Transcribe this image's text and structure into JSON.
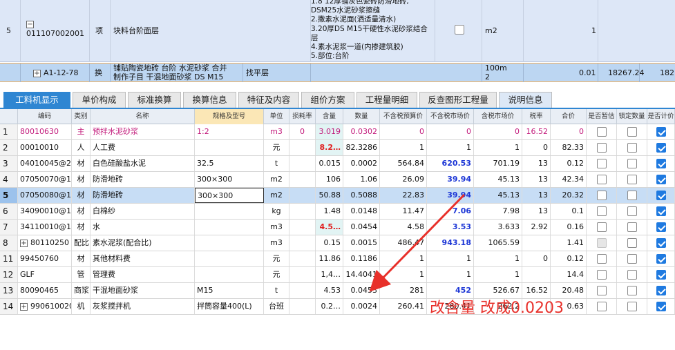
{
  "upper": {
    "row5": {
      "index": "5",
      "code": "011107002001",
      "kind": "项",
      "name": "块料台阶面层",
      "desc_lines": [
        "1.8 12厚铺灰色瓷砖防滑地砖,",
        "DSM25水泥砂浆擦缝",
        "2.撒素水泥面(洒适量清水)",
        "3.20厚DS M15干硬性水泥砂浆结合",
        "层",
        "4.素水泥浆一道(内掺建筑胶)",
        "5.部位:台阶"
      ],
      "unit": "m2",
      "qty": "1"
    },
    "edit_row": {
      "code": "A1-12-78",
      "kind": "换",
      "name_line1": "铺贴陶瓷地砖 台阶 水泥砂浆  合并",
      "name_line2": "制作子目 干混地面砂浆 DS M15",
      "extra": "找平层",
      "unit_line1": "100m",
      "unit_line2": "2",
      "qty": "0.01",
      "price": "18267.24",
      "total": "182."
    }
  },
  "tabs": [
    "工料机显示",
    "单价构成",
    "标准换算",
    "换算信息",
    "特征及内容",
    "组价方案",
    "工程量明细",
    "反查图形工程量",
    "说明信息"
  ],
  "columns": [
    "编码",
    "类别",
    "名称",
    "规格及型号",
    "单位",
    "损耗率",
    "含量",
    "数量",
    "不含税预算价",
    "不含税市场价",
    "含税市场价",
    "税率",
    "合价",
    "是否暂估",
    "锁定数量",
    "是否计价"
  ],
  "rows": [
    {
      "n": "1",
      "code": "80010630",
      "type": "主",
      "name": "预拌水泥砂浆",
      "spec": "1:2",
      "unit": "m3",
      "loss": "0",
      "content": "3.019",
      "qty": "0.0302",
      "budget": "0",
      "market": "0",
      "taxmarket": "0",
      "rate": "16.52",
      "total": "0",
      "est": false,
      "lock": false,
      "calc": true
    },
    {
      "n": "2",
      "code": "00010010",
      "type": "人",
      "name": "人工费",
      "spec": "",
      "unit": "元",
      "loss": "",
      "content": "8.2…",
      "qty": "82.3286",
      "budget": "1",
      "market": "1",
      "taxmarket": "1",
      "rate": "0",
      "total": "82.33",
      "est": false,
      "lock": false,
      "calc": true
    },
    {
      "n": "3",
      "code": "04010045@2",
      "type": "材",
      "name": "白色硅酸盐水泥",
      "spec": "32.5",
      "unit": "t",
      "loss": "",
      "content": "0.015",
      "qty": "0.0002",
      "budget": "564.84",
      "market": "620.53",
      "taxmarket": "701.19",
      "rate": "13",
      "total": "0.12",
      "est": false,
      "lock": false,
      "calc": true
    },
    {
      "n": "4",
      "code": "07050070@1",
      "type": "材",
      "name": "防滑地砖",
      "spec": "300×300",
      "unit": "m2",
      "loss": "",
      "content": "106",
      "qty": "1.06",
      "budget": "26.09",
      "market": "39.94",
      "taxmarket": "45.13",
      "rate": "13",
      "total": "42.34",
      "est": false,
      "lock": false,
      "calc": true
    },
    {
      "n": "5",
      "code": "07050080@1",
      "type": "材",
      "name": "防滑地砖",
      "spec": "300×300",
      "unit": "m2",
      "loss": "",
      "content": "50.88",
      "qty": "0.5088",
      "budget": "22.83",
      "market": "39.94",
      "taxmarket": "45.13",
      "rate": "13",
      "total": "20.32",
      "est": false,
      "lock": false,
      "calc": true
    },
    {
      "n": "6",
      "code": "34090010@1",
      "type": "材",
      "name": "白棉纱",
      "spec": "",
      "unit": "kg",
      "loss": "",
      "content": "1.48",
      "qty": "0.0148",
      "budget": "11.47",
      "market": "7.06",
      "taxmarket": "7.98",
      "rate": "13",
      "total": "0.1",
      "est": false,
      "lock": false,
      "calc": true
    },
    {
      "n": "7",
      "code": "34110010@1",
      "type": "材",
      "name": "水",
      "spec": "",
      "unit": "m3",
      "loss": "",
      "content": "4.5…",
      "qty": "0.0454",
      "budget": "4.58",
      "market": "3.53",
      "taxmarket": "3.633",
      "rate": "2.92",
      "total": "0.16",
      "est": false,
      "lock": false,
      "calc": true
    },
    {
      "n": "8",
      "code": "80110250",
      "type": "配比",
      "name": "素水泥浆(配合比)",
      "spec": "",
      "unit": "m3",
      "loss": "",
      "content": "0.15",
      "qty": "0.0015",
      "budget": "486.47",
      "market": "943.18",
      "taxmarket": "1065.59",
      "rate": "",
      "total": "1.41",
      "est": false,
      "lock": false,
      "calc": true
    },
    {
      "n": "11",
      "code": "99450760",
      "type": "材",
      "name": "其他材料费",
      "spec": "",
      "unit": "元",
      "loss": "",
      "content": "11.86",
      "qty": "0.1186",
      "budget": "1",
      "market": "1",
      "taxmarket": "1",
      "rate": "0",
      "total": "0.12",
      "est": false,
      "lock": false,
      "calc": true
    },
    {
      "n": "12",
      "code": "GLF",
      "type": "管",
      "name": "管理费",
      "spec": "",
      "unit": "元",
      "loss": "",
      "content": "1,4…",
      "qty": "14.4041",
      "budget": "1",
      "market": "1",
      "taxmarket": "1",
      "rate": "",
      "total": "14.4",
      "est": false,
      "lock": false,
      "calc": true
    },
    {
      "n": "13",
      "code": "80090465",
      "type": "商浆",
      "name": "干混地面砂浆",
      "spec": "M15",
      "unit": "t",
      "loss": "",
      "content": "4.53",
      "qty": "0.0453",
      "budget": "281",
      "market": "452",
      "taxmarket": "526.67",
      "rate": "16.52",
      "total": "20.48",
      "est": false,
      "lock": false,
      "calc": true
    },
    {
      "n": "14",
      "code": "990610020",
      "type": "机",
      "name": "灰浆搅拌机",
      "spec": "拌筒容量400(L)",
      "unit": "台班",
      "loss": "",
      "content": "0.2…",
      "qty": "0.0024",
      "budget": "260.41",
      "market": "260.41",
      "taxmarket": "262.2",
      "rate": "",
      "total": "0.63",
      "est": false,
      "lock": false,
      "calc": true
    }
  ],
  "annotation": "改含量 改成0.0203",
  "colors": {
    "accent": "#2f86d2",
    "annotation": "#e8302a",
    "market_price": "#1c36d6"
  }
}
